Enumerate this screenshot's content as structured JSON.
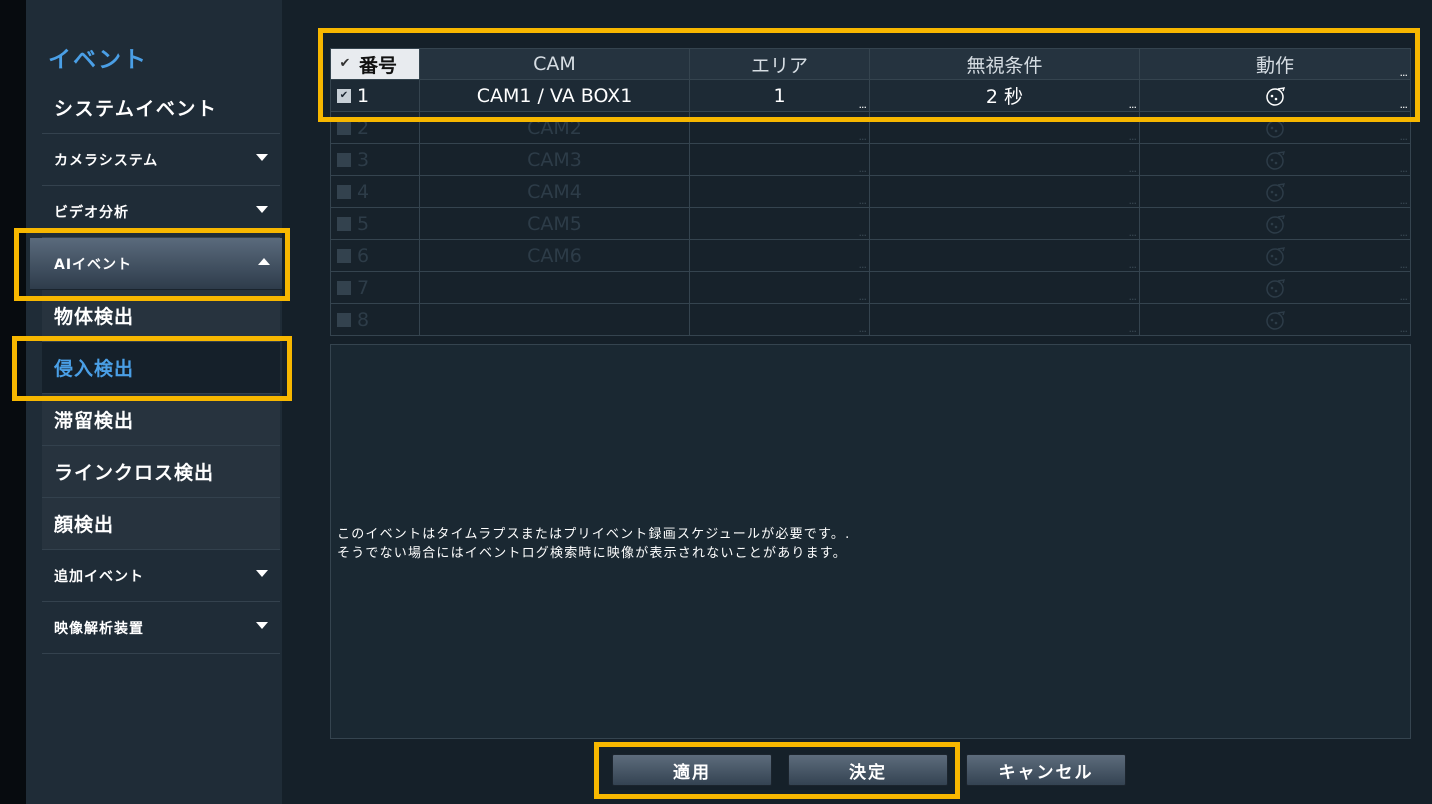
{
  "sidebar": {
    "title": "イベント",
    "system_event": "システムイベント",
    "camera_system": "カメラシステム",
    "video_analytics": "ビデオ分析",
    "ai_event": "AIイベント",
    "ai_sub": [
      "物体検出",
      "侵入検出",
      "滞留検出",
      "ラインクロス検出",
      "顔検出"
    ],
    "selected_sub": "侵入検出",
    "extra_event": "追加イベント",
    "video_analyzer": "映像解析装置"
  },
  "table": {
    "headers": {
      "no": "番号",
      "cam": "CAM",
      "area": "エリア",
      "ignore": "無視条件",
      "action": "動作"
    },
    "rows": [
      {
        "no": "1",
        "cam": "CAM1 / VA BOX1",
        "area": "1",
        "ignore": "2 秒",
        "checked": true,
        "active": true
      },
      {
        "no": "2",
        "cam": "CAM2",
        "area": "",
        "ignore": "",
        "checked": false,
        "active": false
      },
      {
        "no": "3",
        "cam": "CAM3",
        "area": "",
        "ignore": "",
        "checked": false,
        "active": false
      },
      {
        "no": "4",
        "cam": "CAM4",
        "area": "",
        "ignore": "",
        "checked": false,
        "active": false
      },
      {
        "no": "5",
        "cam": "CAM5",
        "area": "",
        "ignore": "",
        "checked": false,
        "active": false
      },
      {
        "no": "6",
        "cam": "CAM6",
        "area": "",
        "ignore": "",
        "checked": false,
        "active": false
      },
      {
        "no": "7",
        "cam": "",
        "area": "",
        "ignore": "",
        "checked": false,
        "active": false
      },
      {
        "no": "8",
        "cam": "",
        "area": "",
        "ignore": "",
        "checked": false,
        "active": false
      }
    ],
    "action_icon": "settings-dial-icon",
    "ellipsis": "..."
  },
  "info": {
    "line1": "このイベントはタイムラプスまたはプリイベント録画スケジュールが必要です。.",
    "line2": "そうでない場合にはイベントログ検索時に映像が表示されないことがあります。"
  },
  "buttons": {
    "apply": "適用",
    "ok": "決定",
    "cancel": "キャンセル"
  },
  "colors": {
    "accent": "#4a9fe6",
    "highlight": "#f7b700"
  }
}
